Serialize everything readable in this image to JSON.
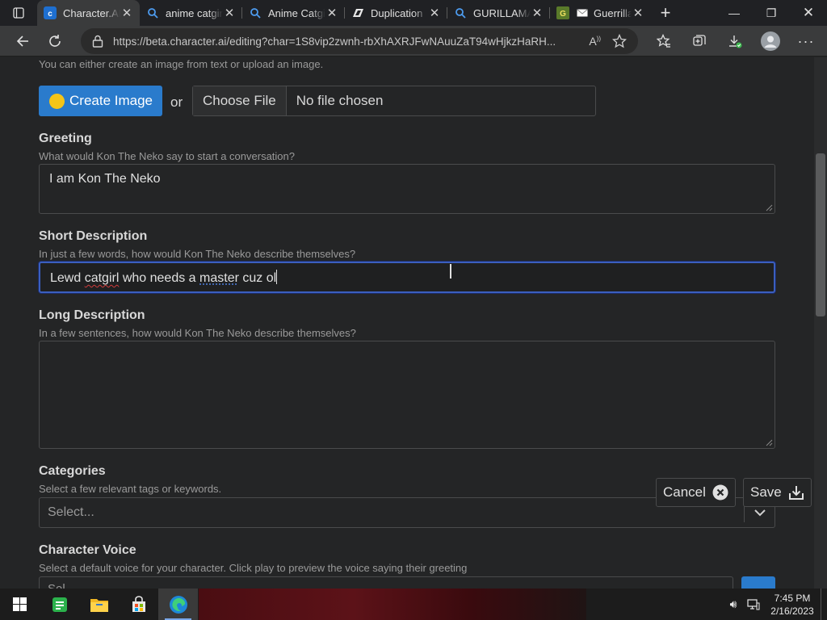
{
  "browser": {
    "tabs": [
      {
        "title": "Character.AI",
        "favicon": "character-ai-icon",
        "active": true
      },
      {
        "title": "anime catgirl",
        "favicon": "search-icon"
      },
      {
        "title": "Anime Catgirl",
        "favicon": "search-icon"
      },
      {
        "title": "Duplication",
        "favicon": "duplication-icon"
      },
      {
        "title": "GURILLAMA",
        "favicon": "search-icon"
      },
      {
        "title": "Guerrilla",
        "favicon": "guerrilla-icon"
      }
    ],
    "url": "https://beta.character.ai/editing?char=1S8vip2zwnh-rbXhAXRJFwNAuuZaT94wHjkzHaRH..."
  },
  "form": {
    "image_help": "You can either create an image from text or upload an image.",
    "create_image_label": "Create Image",
    "or_text": "or",
    "choose_file_label": "Choose File",
    "no_file_text": "No file chosen",
    "greeting": {
      "label": "Greeting",
      "help": "What would Kon The Neko say to start a conversation?",
      "value": "I am Kon The Neko"
    },
    "short_description": {
      "label": "Short Description",
      "help": "In just a few words, how would Kon The Neko describe themselves?",
      "value_parts": [
        "Lewd ",
        "catgirl",
        " who needs a ",
        "master",
        " cuz ol"
      ]
    },
    "long_description": {
      "label": "Long Description",
      "help": "In a few sentences, how would Kon The Neko describe themselves?",
      "value": ""
    },
    "categories": {
      "label": "Categories",
      "help": "Select a few relevant tags or keywords.",
      "placeholder": "Select..."
    },
    "voice": {
      "label": "Character Voice",
      "help": "Select a default voice for your character. Click play to preview the voice saying their greeting",
      "value": "Sel..."
    },
    "cancel_label": "Cancel",
    "save_label": "Save"
  },
  "taskbar": {
    "time": "7:45 PM",
    "date": "2/16/2023"
  },
  "colors": {
    "accent": "#2a7bcc",
    "focus": "#3b5fbf",
    "background": "#242526"
  }
}
